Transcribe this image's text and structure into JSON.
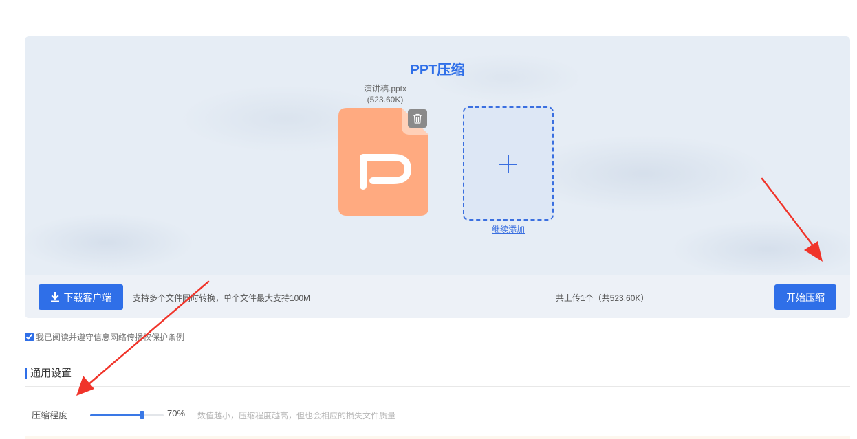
{
  "panel": {
    "title": "PPT压缩"
  },
  "file": {
    "name": "演讲稿.pptx",
    "size": "(523.60K)",
    "icon": "ppt-file-icon",
    "color": "#ffaa80"
  },
  "add": {
    "link_label": "继续添加"
  },
  "action_bar": {
    "download_label": "下载客户端",
    "support_text": "支持多个文件同时转换，单个文件最大支持100M",
    "upload_count": "共上传1个（共523.60K）",
    "start_label": "开始压缩"
  },
  "agreement": {
    "checked": true,
    "text": "我已阅读并遵守信息网络传播权保护条例"
  },
  "settings": {
    "section_title": "通用设置",
    "compress_label": "压缩程度",
    "compress_percent": 70,
    "compress_value": "70%",
    "compress_hint": "数值越小，压缩程度越高，但也会相应的损失文件质量"
  },
  "colors": {
    "accent": "#2f6fe8",
    "annotation": "#f0342a"
  }
}
